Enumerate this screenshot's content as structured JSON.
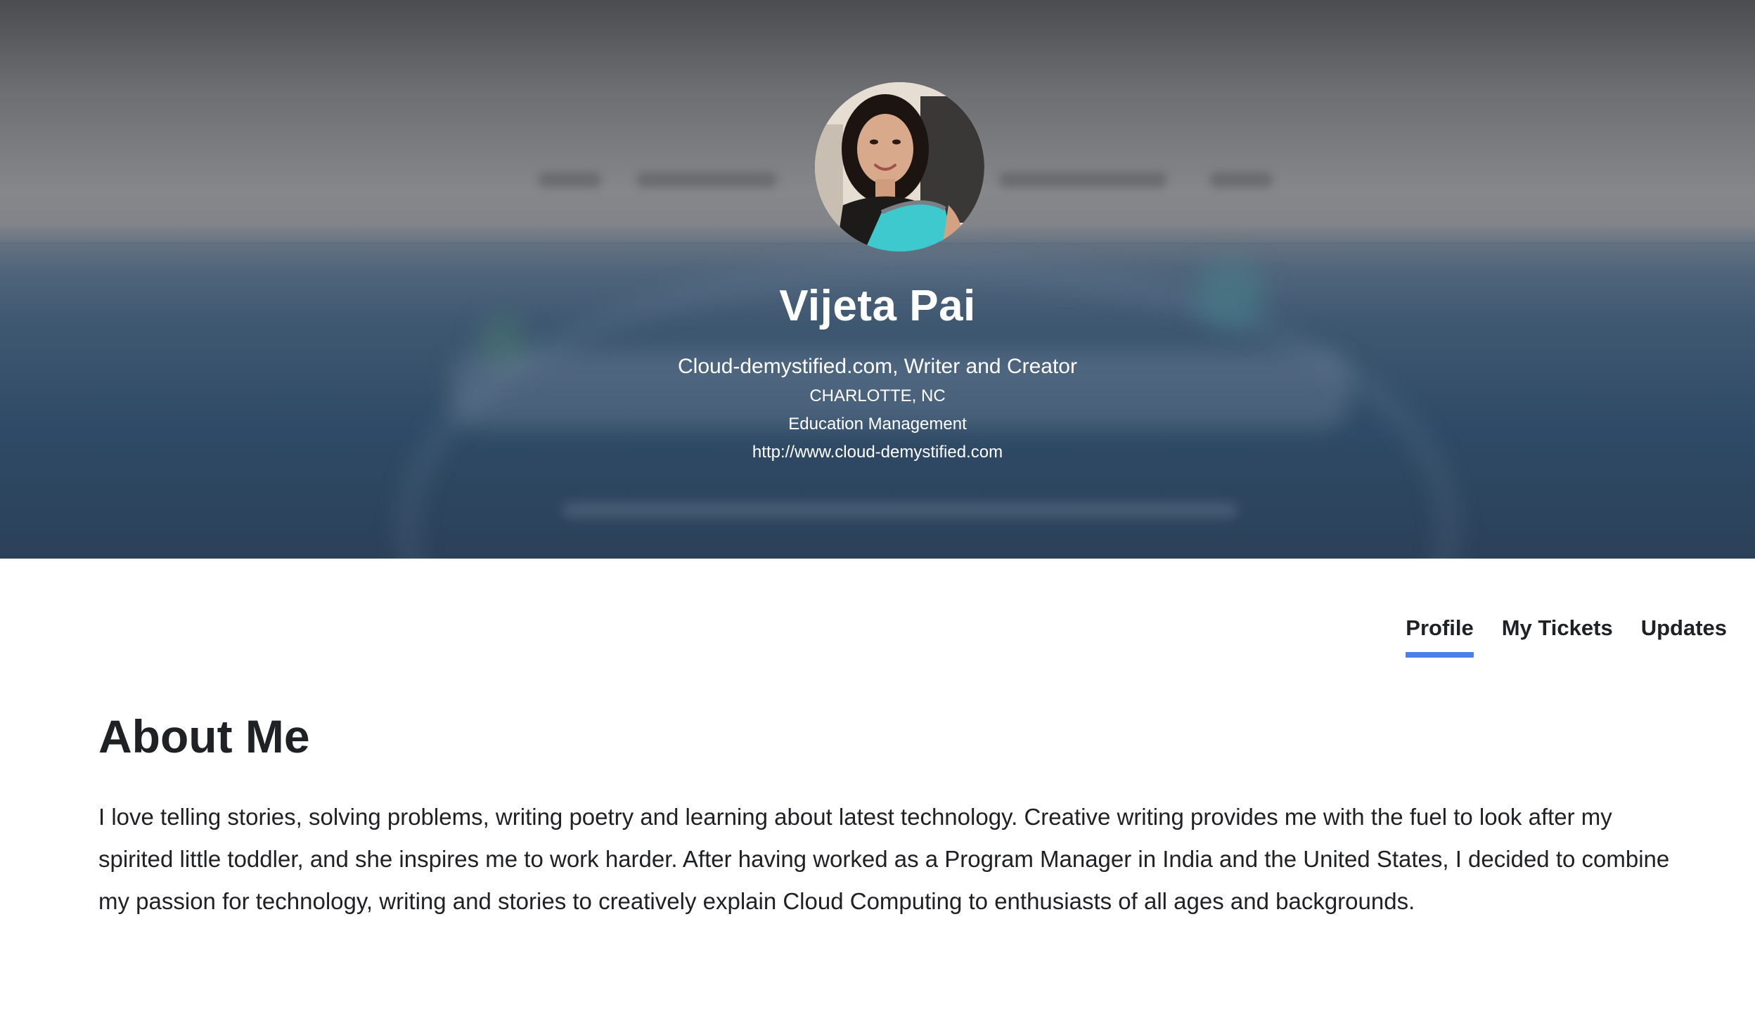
{
  "profile": {
    "name": "Vijeta Pai",
    "title": "Cloud-demystified.com, Writer and Creator",
    "location": "CHARLOTTE, NC",
    "industry": "Education Management",
    "website": "http://www.cloud-demystified.com"
  },
  "tabs": [
    {
      "label": "Profile",
      "active": true
    },
    {
      "label": "My Tickets",
      "active": false
    },
    {
      "label": "Updates",
      "active": false
    }
  ],
  "about": {
    "heading": "About Me",
    "body": "I love telling stories, solving problems, writing poetry and learning about latest technology. Creative writing provides me with the fuel to look after my spirited little toddler, and she inspires me to work harder. After having worked as a Program Manager in India and the United States, I decided to combine my passion for technology, writing and stories to creatively explain Cloud Computing to enthusiasts of all ages and backgrounds."
  },
  "colors": {
    "accent": "#4a80e8",
    "text": "#202124",
    "hero_text": "#ffffff"
  }
}
